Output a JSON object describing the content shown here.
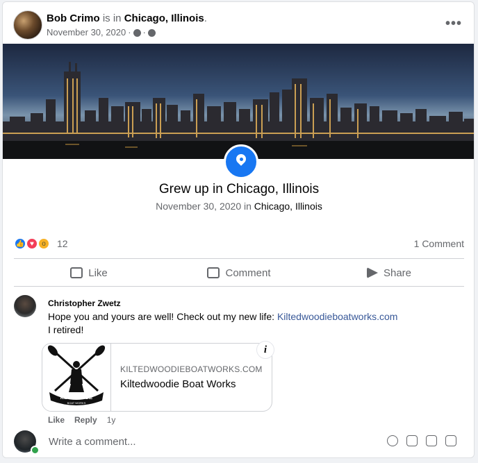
{
  "post": {
    "author": "Bob Crimo",
    "is_in": "is in",
    "location": "Chicago, Illinois",
    "period": ".",
    "date": "November 30, 2020",
    "sep": "·",
    "more_label": "•••"
  },
  "life_event": {
    "title": "Grew up in Chicago, Illinois",
    "date": "November 30, 2020",
    "in": "in",
    "place": "Chicago, Illinois"
  },
  "reactions": {
    "count": "12",
    "comments": "1 Comment"
  },
  "actions": [
    {
      "label": "Like",
      "icon": "thumbs-up-icon"
    },
    {
      "label": "Comment",
      "icon": "comment-bubble-icon"
    },
    {
      "label": "Share",
      "icon": "share-arrow-icon"
    }
  ],
  "comment": {
    "author": "Christopher Zwetz",
    "text": "Hope you and yours are well! Check out my new life:",
    "link": "Kiltedwoodieboatworks.com",
    "text2": "I retired!",
    "like": "Like",
    "reply": "Reply",
    "age": "1y"
  },
  "link_preview": {
    "domain": "KILTEDWOODIEBOATWORKS.COM",
    "title": "Kiltedwoodie Boat Works",
    "logo_text": "KILTEDWOODIE",
    "logo_sub": "BOAT WORKS",
    "info_glyph": "i"
  },
  "write_comment": {
    "placeholder": "Write a comment..."
  },
  "colors": {
    "accent": "#1877f2",
    "link": "#385898",
    "secondary": "#65676b"
  }
}
